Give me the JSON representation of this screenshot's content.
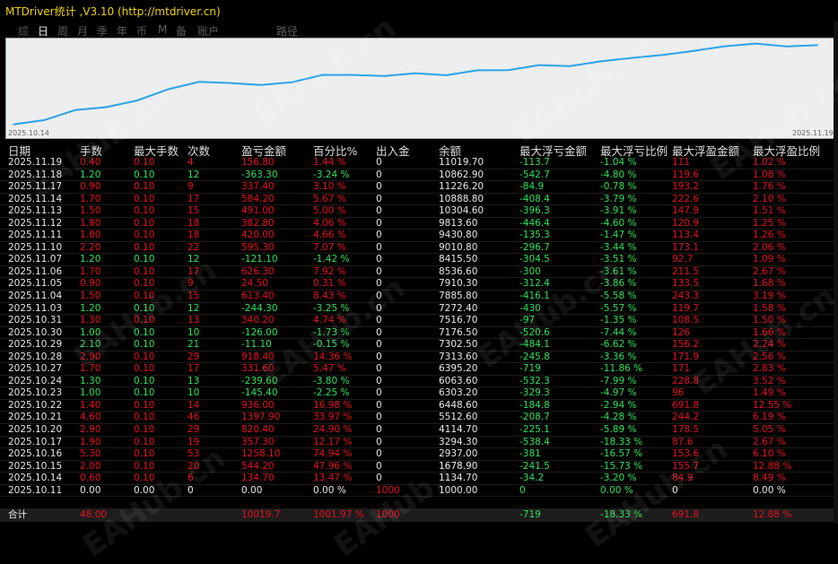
{
  "window_title": "MTDriver统计 ,V3.10 (http://mtdriver.cn)",
  "tabs": [
    "综",
    "日",
    "周",
    "月",
    "季",
    "年",
    "币",
    "M",
    "备",
    "账户",
    "路径"
  ],
  "active_tab": "日",
  "chart": {
    "start_label": "2025.10.14",
    "end_label": "2025.11.19",
    "line_color": "#2aa3e6"
  },
  "chart_data": {
    "type": "line",
    "x": [
      "2025.10.14",
      "2025.10.15",
      "2025.10.16",
      "2025.10.17",
      "2025.10.20",
      "2025.10.21",
      "2025.10.22",
      "2025.10.23",
      "2025.10.24",
      "2025.10.27",
      "2025.10.28",
      "2025.10.29",
      "2025.10.30",
      "2025.10.31",
      "2025.11.03",
      "2025.11.04",
      "2025.11.05",
      "2025.11.06",
      "2025.11.07",
      "2025.11.10",
      "2025.11.11",
      "2025.11.12",
      "2025.11.13",
      "2025.11.14",
      "2025.11.17",
      "2025.11.18",
      "2025.11.19"
    ],
    "y": [
      1134.7,
      1678.9,
      2937.0,
      3294.3,
      4114.7,
      5512.6,
      6448.6,
      6303.2,
      6063.6,
      6395.2,
      7313.6,
      7302.5,
      7176.5,
      7516.7,
      7272.4,
      7885.8,
      7910.3,
      8536.6,
      8415.5,
      9010.8,
      9430.8,
      9813.6,
      10304.6,
      10888.8,
      11226.2,
      10862.9,
      11019.7
    ]
  },
  "headers": [
    "日期",
    "手数",
    "最大手数",
    "次数",
    "盈亏金额",
    "百分比%",
    "出入金",
    "余额",
    "最大浮亏金额",
    "最大浮亏比例",
    "最大浮盈金额",
    "最大浮盈比例"
  ],
  "rows": [
    [
      "2025.11.19",
      "0.40",
      "0.10",
      "4",
      "156.80",
      "1.44 %",
      "0",
      "11019.70",
      "-113.7",
      "-1.04 %",
      "111",
      "1.02 %"
    ],
    [
      "2025.11.18",
      "1.20",
      "0.10",
      "12",
      "-363.30",
      "-3.24 %",
      "0",
      "10862.90",
      "-542.7",
      "-4.80 %",
      "119.6",
      "1.08 %"
    ],
    [
      "2025.11.17",
      "0.90",
      "0.10",
      "9",
      "337.40",
      "3.10 %",
      "0",
      "11226.20",
      "-84.9",
      "-0.78 %",
      "193.2",
      "1.76 %"
    ],
    [
      "2025.11.14",
      "1.70",
      "0.10",
      "17",
      "584.20",
      "5.67 %",
      "0",
      "10888.80",
      "-408.4",
      "-3.79 %",
      "222.6",
      "2.10 %"
    ],
    [
      "2025.11.13",
      "1.50",
      "0.10",
      "15",
      "491.00",
      "5.00 %",
      "0",
      "10304.60",
      "-396.3",
      "-3.91 %",
      "147.9",
      "1.51 %"
    ],
    [
      "2025.11.12",
      "1.80",
      "0.10",
      "18",
      "382.80",
      "4.06 %",
      "0",
      "9813.60",
      "-446.4",
      "-4.60 %",
      "120.9",
      "1.25 %"
    ],
    [
      "2025.11.11",
      "1.80",
      "0.10",
      "18",
      "420.00",
      "4.66 %",
      "0",
      "9430.80",
      "-135.3",
      "-1.47 %",
      "113.4",
      "1.26 %"
    ],
    [
      "2025.11.10",
      "2.20",
      "0.10",
      "22",
      "595.30",
      "7.07 %",
      "0",
      "9010.80",
      "-296.7",
      "-3.44 %",
      "173.1",
      "2.06 %"
    ],
    [
      "2025.11.07",
      "1.20",
      "0.10",
      "12",
      "-121.10",
      "-1.42 %",
      "0",
      "8415.50",
      "-304.5",
      "-3.51 %",
      "92.7",
      "1.09 %"
    ],
    [
      "2025.11.06",
      "1.70",
      "0.10",
      "17",
      "626.30",
      "7.92 %",
      "0",
      "8536.60",
      "-300",
      "-3.61 %",
      "211.5",
      "2.67 %"
    ],
    [
      "2025.11.05",
      "0.90",
      "0.10",
      "9",
      "24.50",
      "0.31 %",
      "0",
      "7910.30",
      "-312.4",
      "-3.86 %",
      "133.5",
      "1.68 %"
    ],
    [
      "2025.11.04",
      "1.50",
      "0.10",
      "15",
      "613.40",
      "8.43 %",
      "0",
      "7885.80",
      "-416.1",
      "-5.58 %",
      "243.3",
      "3.19 %"
    ],
    [
      "2025.11.03",
      "1.20",
      "0.10",
      "12",
      "-244.30",
      "-3.25 %",
      "0",
      "7272.40",
      "-430",
      "-5.57 %",
      "119.7",
      "1.58 %"
    ],
    [
      "2025.10.31",
      "1.30",
      "0.10",
      "13",
      "340.20",
      "4.74 %",
      "0",
      "7516.70",
      "-97",
      "-1.35 %",
      "108.5",
      "1.50 %"
    ],
    [
      "2025.10.30",
      "1.00",
      "0.10",
      "10",
      "-126.00",
      "-1.73 %",
      "0",
      "7176.50",
      "-520.6",
      "-7.44 %",
      "126",
      "1.66 %"
    ],
    [
      "2025.10.29",
      "2.10",
      "0.10",
      "21",
      "-11.10",
      "-0.15 %",
      "0",
      "7302.50",
      "-484.1",
      "-6.62 %",
      "156.2",
      "2.24 %"
    ],
    [
      "2025.10.28",
      "2.90",
      "0.10",
      "29",
      "918.40",
      "14.36 %",
      "0",
      "7313.60",
      "-245.8",
      "-3.36 %",
      "171.9",
      "2.56 %"
    ],
    [
      "2025.10.27",
      "1.70",
      "0.10",
      "17",
      "331.60",
      "5.47 %",
      "0",
      "6395.20",
      "-719",
      "-11.86 %",
      "171",
      "2.83 %"
    ],
    [
      "2025.10.24",
      "1.30",
      "0.10",
      "13",
      "-239.60",
      "-3.80 %",
      "0",
      "6063.60",
      "-532.3",
      "-7.99 %",
      "228.8",
      "3.52 %"
    ],
    [
      "2025.10.23",
      "1.00",
      "0.10",
      "10",
      "-145.40",
      "-2.25 %",
      "0",
      "6303.20",
      "-329.3",
      "-4.97 %",
      "96",
      "1.49 %"
    ],
    [
      "2025.10.22",
      "1.40",
      "0.10",
      "14",
      "936.00",
      "16.98 %",
      "0",
      "6448.60",
      "-184.8",
      "-2.94 %",
      "691.8",
      "12.55 %"
    ],
    [
      "2025.10.21",
      "4.60",
      "0.10",
      "46",
      "1397.90",
      "33.97 %",
      "0",
      "5512.60",
      "-208.7",
      "-4.28 %",
      "244.2",
      "6.19 %"
    ],
    [
      "2025.10.20",
      "2.90",
      "0.10",
      "29",
      "820.40",
      "24.90 %",
      "0",
      "4114.70",
      "-225.1",
      "-5.89 %",
      "178.5",
      "5.05 %"
    ],
    [
      "2025.10.17",
      "1.90",
      "0.10",
      "19",
      "357.30",
      "12.17 %",
      "0",
      "3294.30",
      "-538.4",
      "-18.33 %",
      "87.6",
      "2.67 %"
    ],
    [
      "2025.10.16",
      "5.30",
      "0.10",
      "53",
      "1258.10",
      "74.94 %",
      "0",
      "2937.00",
      "-381",
      "-16.57 %",
      "153.6",
      "6.10 %"
    ],
    [
      "2025.10.15",
      "2.00",
      "0.10",
      "20",
      "544.20",
      "47.96 %",
      "0",
      "1678.90",
      "-241.5",
      "-15.73 %",
      "155.7",
      "12.88 %"
    ],
    [
      "2025.10.14",
      "0.60",
      "0.10",
      "6",
      "134.70",
      "13.47 %",
      "0",
      "1134.70",
      "-34.2",
      "-3.20 %",
      "84.9",
      "8.49 %"
    ],
    [
      "2025.10.11",
      "0.00",
      "0.00",
      "0",
      "0.00",
      "0.00 %",
      "1000",
      "1000.00",
      "0",
      "0.00 %",
      "0",
      "0.00 %"
    ]
  ],
  "total": [
    "合计",
    "48.00",
    "",
    "",
    "10019.7",
    "1001.97 %",
    "1000",
    "",
    "-719",
    "-18.33 %",
    "691.8",
    "12.88 %"
  ],
  "watermark": "EAHub.cn"
}
